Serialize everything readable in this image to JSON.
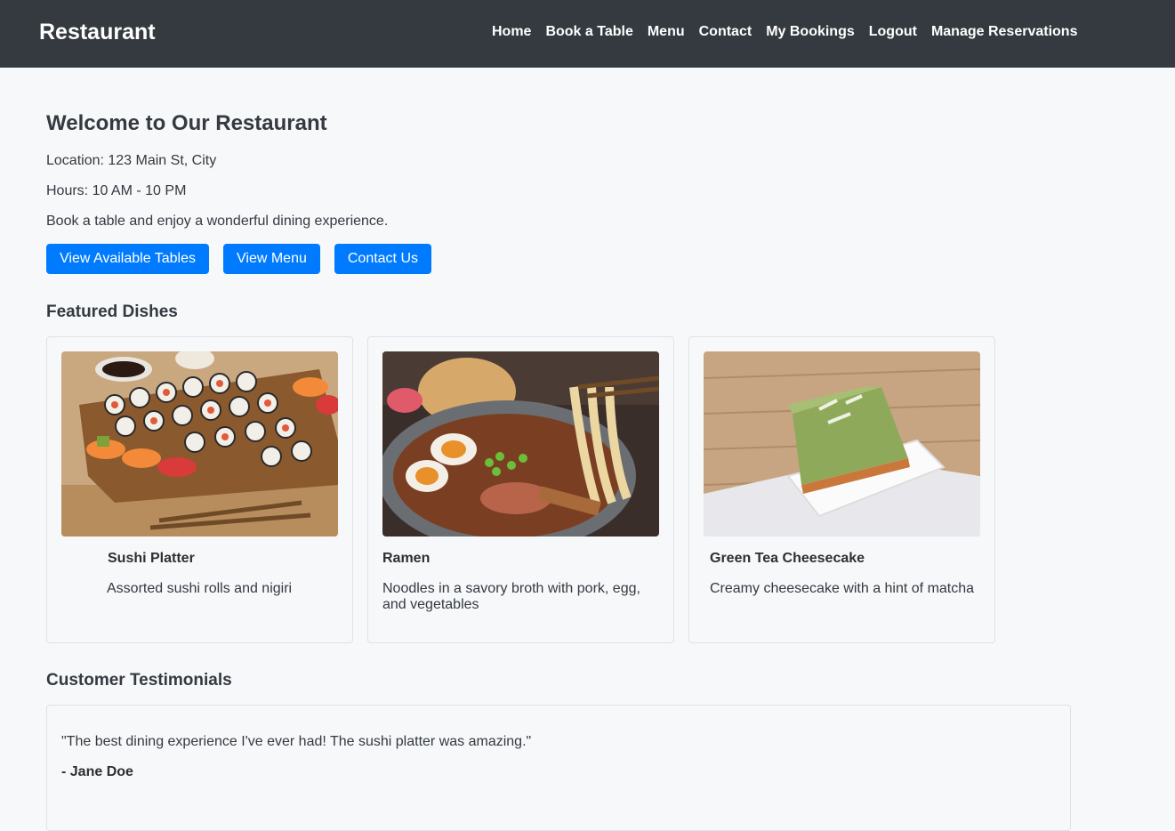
{
  "nav": {
    "brand": "Restaurant",
    "links": [
      "Home",
      "Book a Table",
      "Menu",
      "Contact",
      "My Bookings",
      "Logout",
      "Manage Reservations"
    ]
  },
  "hero": {
    "title": "Welcome to Our Restaurant",
    "location": "Location: 123 Main St, City",
    "hours": "Hours: 10 AM - 10 PM",
    "tagline": "Book a table and enjoy a wonderful dining experience.",
    "buttons": [
      "View Available Tables",
      "View Menu",
      "Contact Us"
    ]
  },
  "featured": {
    "heading": "Featured Dishes",
    "dishes": [
      {
        "name": "Sushi Platter",
        "description": "Assorted sushi rolls and nigiri",
        "image": "sushi-photo"
      },
      {
        "name": "Ramen",
        "description": "Noodles in a savory broth with pork, egg, and vegetables",
        "image": "ramen-photo"
      },
      {
        "name": "Green Tea Cheesecake",
        "description": "Creamy cheesecake with a hint of matcha",
        "image": "cheesecake-photo"
      }
    ]
  },
  "testimonials": {
    "heading": "Customer Testimonials",
    "items": [
      {
        "quote": "\"The best dining experience I've ever had! The sushi platter was amazing.\"",
        "author": "- Jane Doe"
      }
    ]
  },
  "colors": {
    "navbar": "#343a40",
    "primary_button": "#007bff",
    "background": "#f7f8fa"
  }
}
